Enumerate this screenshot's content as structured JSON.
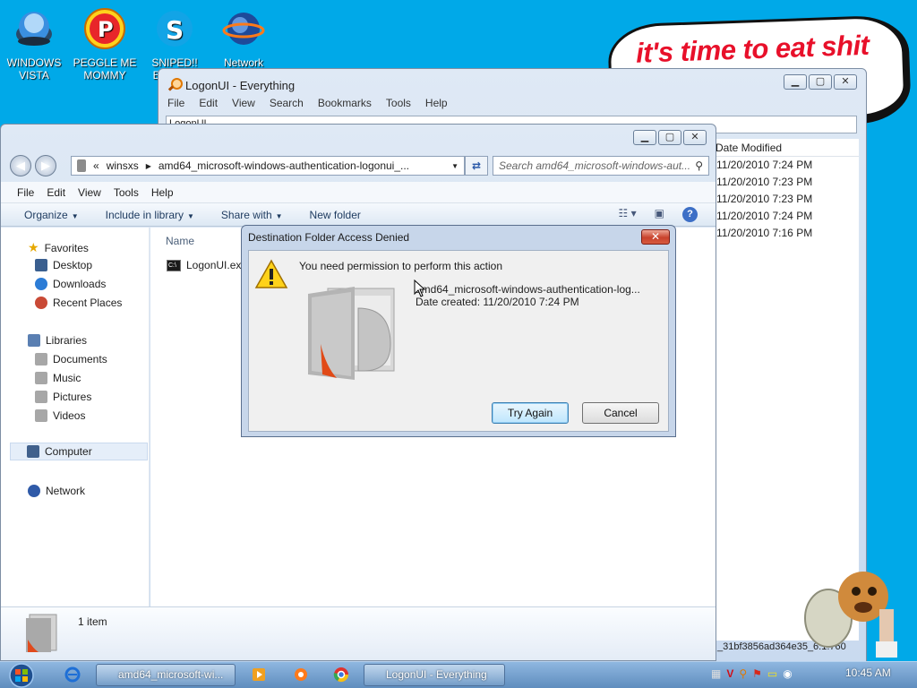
{
  "desktop": {
    "icons": [
      {
        "label": "WINDOWS VISTA"
      },
      {
        "label": "PEGGLE ME MOMMY"
      },
      {
        "label": "SNIPED!! EPIC GA"
      },
      {
        "label": "Network"
      }
    ],
    "bubble_text": "it's time to eat shit"
  },
  "everything": {
    "title": "LogonUI - Everything",
    "menu": [
      "File",
      "Edit",
      "View",
      "Search",
      "Bookmarks",
      "Tools",
      "Help"
    ],
    "search_value": "LogonUI",
    "column_header": "Date Modified",
    "dates": [
      "11/20/2010 7:24 PM",
      "11/20/2010 7:23 PM",
      "11/20/2010 7:23 PM",
      "11/20/2010 7:24 PM",
      "11/20/2010 7:16 PM"
    ],
    "status_text": "_31bf3856ad364e35_6.1.760"
  },
  "explorer": {
    "breadcrumb_root": "«",
    "breadcrumb_1": "winsxs",
    "breadcrumb_2": "amd64_microsoft-windows-authentication-logonui_...",
    "search_placeholder": "Search amd64_microsoft-windows-aut...",
    "menu": [
      "File",
      "Edit",
      "View",
      "Tools",
      "Help"
    ],
    "commands": {
      "organize": "Organize",
      "include": "Include in library",
      "share": "Share with",
      "newfolder": "New folder"
    },
    "nav": {
      "favorites": "Favorites",
      "desktop": "Desktop",
      "downloads": "Downloads",
      "recent": "Recent Places",
      "libraries": "Libraries",
      "documents": "Documents",
      "music": "Music",
      "pictures": "Pictures",
      "videos": "Videos",
      "computer": "Computer",
      "network": "Network"
    },
    "name_header": "Name",
    "file_name": "LogonUI.exe",
    "item_count": "1 item"
  },
  "dialog": {
    "title": "Destination Folder Access Denied",
    "message": "You need permission to perform this action",
    "folder_name": "amd64_microsoft-windows-authentication-log...",
    "date_created": "Date created: 11/20/2010 7:24 PM",
    "try_again": "Try Again",
    "cancel": "Cancel"
  },
  "taskbar": {
    "task_explorer": "amd64_microsoft-wi...",
    "task_everything": "LogonUI - Everything",
    "clock": "10:45 AM"
  },
  "colors": {
    "desktop": "#00a9e8",
    "bubble_text": "#e8102a",
    "close_red": "#c8422c"
  }
}
